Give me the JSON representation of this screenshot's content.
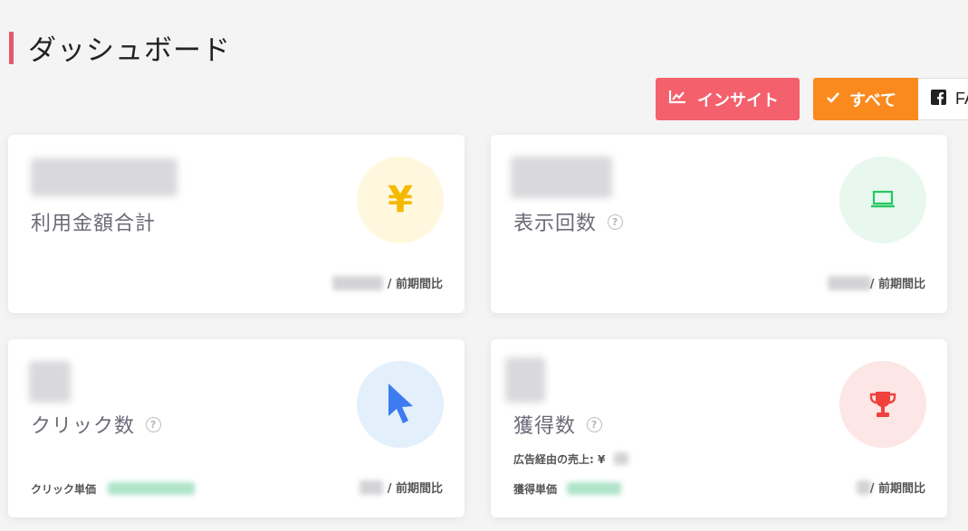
{
  "page": {
    "title": "ダッシュボード"
  },
  "toolbar": {
    "insight_label": "インサイト",
    "all_label": "すべて",
    "fb_label": "FA"
  },
  "cards": [
    {
      "label": "利用金額合計",
      "compare": "/ 前期間比",
      "icon": "yen-icon",
      "icon_glyph": "¥",
      "icon_color": "#f5b900",
      "icon_bg": "#fff8de"
    },
    {
      "label": "表示回数",
      "compare": "/ 前期間比",
      "icon": "laptop-icon",
      "icon_color": "#25c760",
      "icon_bg": "#e8f8ee"
    },
    {
      "label": "クリック数",
      "compare": "/ 前期間比",
      "sub_label": "クリック単価",
      "icon": "cursor-icon",
      "icon_color": "#3d7cf0",
      "icon_bg": "#e3f0fc"
    },
    {
      "label": "獲得数",
      "compare": "/ 前期間比",
      "sub_label": "獲得単価",
      "sales_label": "広告経由の売上: ¥",
      "icon": "trophy-icon",
      "icon_color": "#f0413c",
      "icon_bg": "#fde6e6"
    }
  ],
  "colors": {
    "accent_red": "#f4606c",
    "accent_orange": "#fa8a1e",
    "header_bar": "#e9566b"
  }
}
